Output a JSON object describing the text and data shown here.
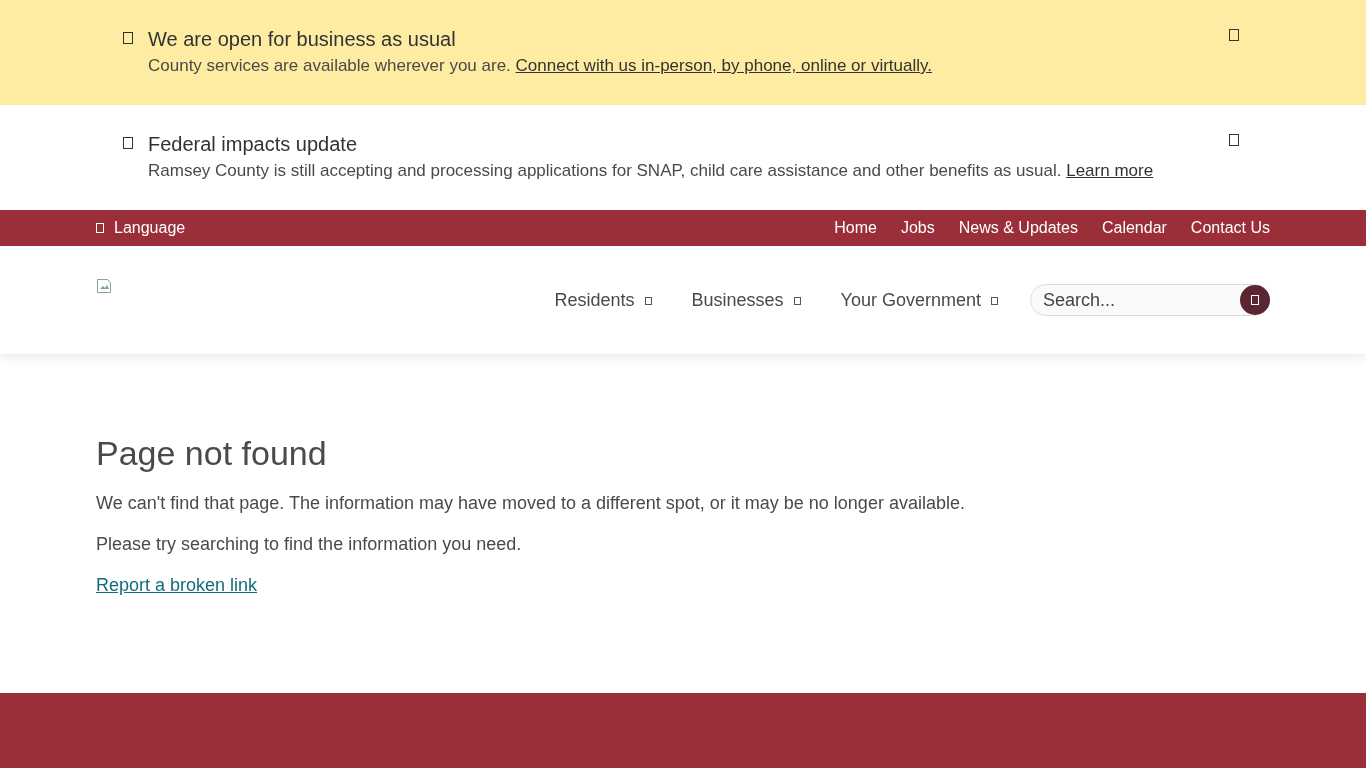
{
  "alerts": [
    {
      "kind": "highlight",
      "title": "We are open for business as usual",
      "text": "County services are available wherever you are.",
      "link": "Connect with us in-person, by phone, online or virtually."
    },
    {
      "kind": "plain",
      "title": "Federal impacts update",
      "text": "Ramsey County is still accepting and processing applications for SNAP, child care assistance and other benefits as usual.",
      "link": "Learn more"
    }
  ],
  "utility_bar": {
    "language": "Language",
    "links": [
      "Home",
      "Jobs",
      "News & Updates",
      "Calendar",
      "Contact Us"
    ]
  },
  "main_nav": [
    "Residents",
    "Businesses",
    "Your Government"
  ],
  "search": {
    "placeholder": "Search..."
  },
  "content": {
    "heading": "Page not found",
    "paragraphs": [
      "We can't find that page. The information may have moved to a different spot, or it may be no longer available.",
      "Please try searching to find the information you need."
    ],
    "link": "Report a broken link"
  }
}
